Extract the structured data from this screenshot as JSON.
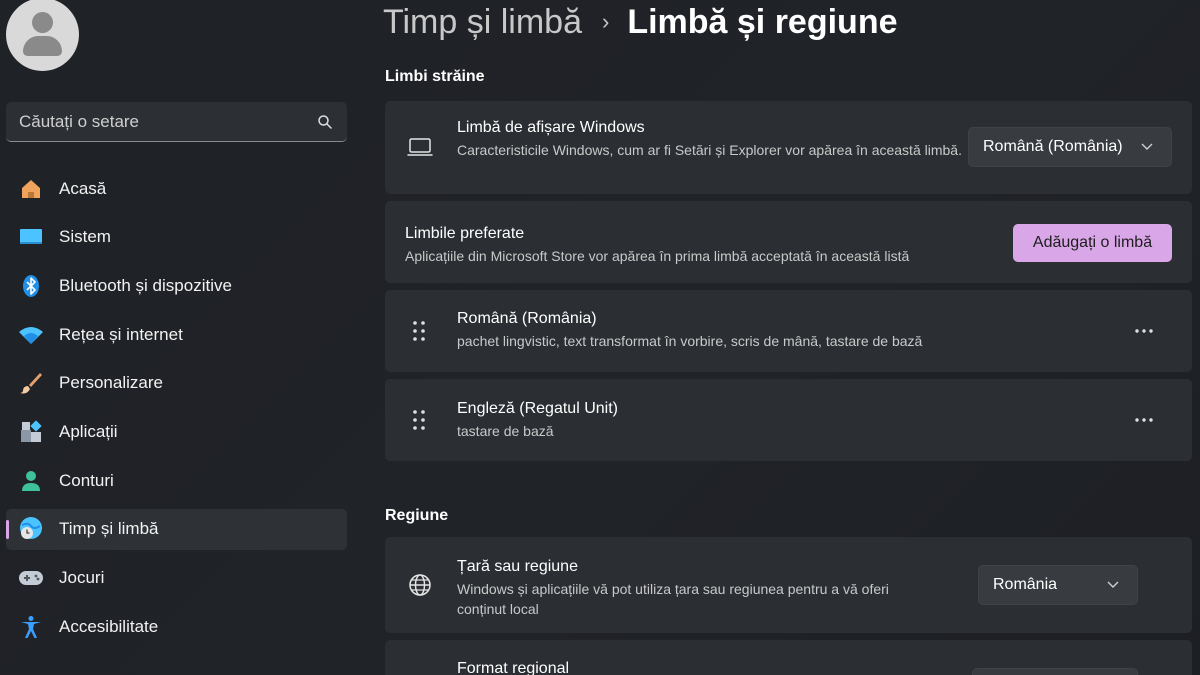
{
  "sidebar": {
    "search_placeholder": "Căutați o setare",
    "items": [
      {
        "label": "Acasă",
        "icon": "home-icon"
      },
      {
        "label": "Sistem",
        "icon": "monitor-icon"
      },
      {
        "label": "Bluetooth și dispozitive",
        "icon": "bluetooth-icon"
      },
      {
        "label": "Rețea și internet",
        "icon": "wifi-icon"
      },
      {
        "label": "Personalizare",
        "icon": "brush-icon"
      },
      {
        "label": "Aplicații",
        "icon": "apps-icon"
      },
      {
        "label": "Conturi",
        "icon": "account-icon"
      },
      {
        "label": "Timp și limbă",
        "icon": "globe-clock-icon",
        "active": true
      },
      {
        "label": "Jocuri",
        "icon": "gamepad-icon"
      },
      {
        "label": "Accesibilitate",
        "icon": "accessibility-icon"
      }
    ]
  },
  "header": {
    "parent": "Timp și limbă",
    "separator": "›",
    "current": "Limbă și regiune"
  },
  "sections": {
    "languages": {
      "title": "Limbi străine",
      "display_language": {
        "title": "Limbă de afișare Windows",
        "desc": "Caracteristicile Windows, cum ar fi Setări și Explorer vor apărea în această limbă.",
        "value": "Română (România)"
      },
      "preferred": {
        "title": "Limbile preferate",
        "desc": "Aplicațiile din Microsoft Store vor apărea în prima limbă acceptată în această listă",
        "button": "Adăugați o limbă"
      },
      "list": [
        {
          "title": "Română (România)",
          "desc": "pachet lingvistic, text transformat în vorbire, scris de mână, tastare de bază"
        },
        {
          "title": "Engleză (Regatul Unit)",
          "desc": "tastare de bază"
        }
      ]
    },
    "region": {
      "title": "Regiune",
      "country": {
        "title": "Țară sau regiune",
        "desc": "Windows și aplicațiile vă pot utiliza țara sau regiunea pentru a vă oferi conținut local",
        "value": "România"
      },
      "format": {
        "title": "Format regional"
      }
    }
  },
  "colors": {
    "accent": "#d9a6e8",
    "card": "#2b2e33",
    "background": "#202328"
  }
}
